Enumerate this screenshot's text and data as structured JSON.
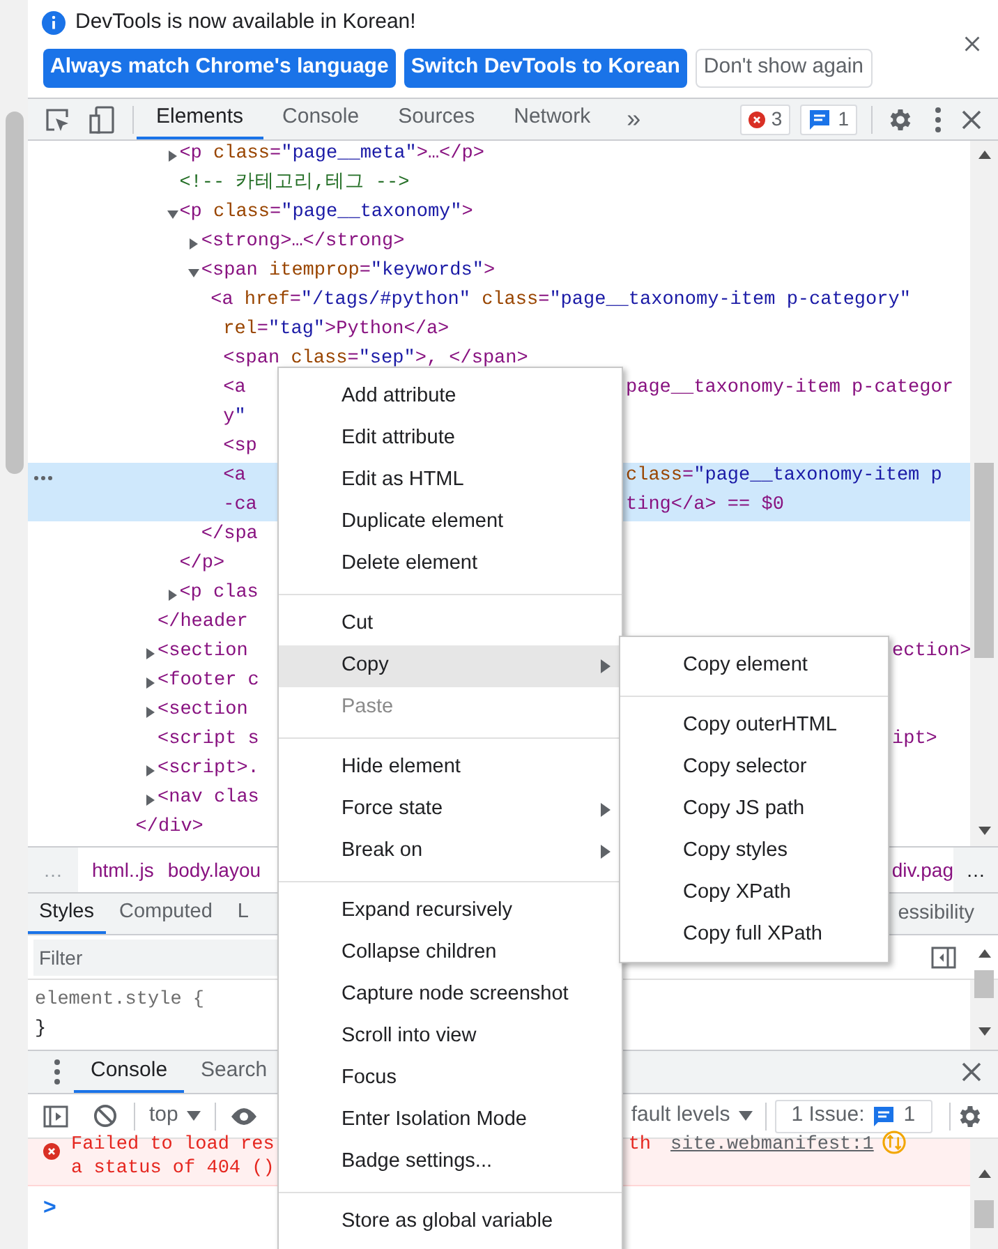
{
  "infobar": {
    "message": "DevTools is now available in Korean!",
    "buttons": [
      {
        "label": "Always match Chrome's language",
        "kind": "primary"
      },
      {
        "label": "Switch DevTools to Korean",
        "kind": "primary"
      },
      {
        "label": "Don't show again",
        "kind": "secondary"
      }
    ]
  },
  "toolbar": {
    "tabs": [
      {
        "label": "Elements",
        "selected": true
      },
      {
        "label": "Console",
        "selected": false
      },
      {
        "label": "Sources",
        "selected": false
      },
      {
        "label": "Network",
        "selected": false
      }
    ],
    "more": "»",
    "errors": "3",
    "messages": "1"
  },
  "elements": {
    "root": {
      "children": [
        {
          "children": [
            {
              "lines": [
                {
                  "text": "<p class=\"page__meta\">…</p>"
                }
              ],
              "expanded": false,
              "selected": false
            },
            {
              "kind": "comment",
              "lines": [
                {
                  "text": "<!-- 카테고리,테그 -->"
                }
              ],
              "selected": false
            },
            {
              "lines": [
                {
                  "text": "<p class=\"page__taxonomy\">"
                }
              ],
              "expanded": true,
              "selected": false,
              "children": [
                {
                  "lines": [
                    {
                      "text": "<strong>…</strong>"
                    }
                  ],
                  "expanded": false,
                  "selected": false
                },
                {
                  "lines": [
                    {
                      "text": "<span itemprop=\"keywords\">"
                    }
                  ],
                  "expanded": true,
                  "selected": false,
                  "children": [
                    {
                      "lines": [
                        {
                          "text": "<a href=\"/tags/#python\" class=\"page__taxonomy-item p-category\""
                        },
                        {
                          "text": "rel=\"tag\">Python</a>"
                        }
                      ],
                      "selected": false
                    },
                    {
                      "lines": [
                        {
                          "text": "<span class=\"sep\">, </span>"
                        }
                      ],
                      "selected": false
                    },
                    {
                      "lines": [
                        {
                          "text": "<a",
                          "after_menu": "page__taxonomy-item p-categor"
                        },
                        {
                          "text": "y\""
                        }
                      ],
                      "selected": false
                    },
                    {
                      "lines": [
                        {
                          "text": "<sp"
                        }
                      ],
                      "selected": false
                    },
                    {
                      "lines": [
                        {
                          "text": "<a",
                          "after_menu": "class=\"page__taxonomy-item p"
                        },
                        {
                          "text": "-ca",
                          "after_menu": "ting</a> == $0"
                        }
                      ],
                      "selected": true
                    }
                  ],
                  "close": "</spa"
                }
              ],
              "close": "</p>"
            },
            {
              "lines": [
                {
                  "text": "<p clas"
                }
              ],
              "expanded": false,
              "selected": false
            }
          ],
          "close": "</header"
        },
        {
          "lines": [
            {
              "text": "<section",
              "after_submenu": "ection>"
            }
          ],
          "expanded": false,
          "selected": false
        },
        {
          "lines": [
            {
              "text": "<footer c"
            }
          ],
          "expanded": false,
          "selected": false
        },
        {
          "lines": [
            {
              "text": "<section"
            }
          ],
          "expanded": false,
          "selected": false
        },
        {
          "lines": [
            {
              "text": "<script s",
              "after_submenu": "ipt>"
            }
          ],
          "selected": false
        },
        {
          "lines": [
            {
              "text": "<script>."
            }
          ],
          "expanded": false,
          "selected": false
        },
        {
          "lines": [
            {
              "text": "<nav clas"
            }
          ],
          "expanded": false,
          "selected": false
        }
      ],
      "close": "</div>"
    }
  },
  "breadcrumbs": {
    "more_left": "…",
    "items": [
      "html..js",
      "body.layou"
    ],
    "right": "div.pag",
    "more_right": "…"
  },
  "styles": {
    "tabs": [
      {
        "label": "Styles",
        "selected": true
      },
      {
        "label": "Computed",
        "selected": false
      },
      {
        "label": "L",
        "selected": false
      }
    ],
    "right_tab": "essibility",
    "filter_placeholder": "Filter",
    "rule_open": "element.style {",
    "rule_close": "}"
  },
  "drawer": {
    "tabs": [
      {
        "label": "Console",
        "selected": true
      },
      {
        "label": "Search",
        "selected": false
      }
    ],
    "context": "top",
    "levels": "fault levels",
    "issues_label": "1 Issue:",
    "issues_count": "1",
    "error": {
      "lines": [
        "Failed to load res",
        "a status of 404 ()"
      ],
      "right": "th",
      "source": "site.webmanifest:1"
    },
    "prompt": ">"
  },
  "context_menu": {
    "items": [
      {
        "kind": "item",
        "label": "Add attribute",
        "submenu": false,
        "selected": false,
        "disabled": false
      },
      {
        "kind": "item",
        "label": "Edit attribute",
        "submenu": false,
        "selected": false,
        "disabled": false
      },
      {
        "kind": "item",
        "label": "Edit as HTML",
        "submenu": false,
        "selected": false,
        "disabled": false
      },
      {
        "kind": "item",
        "label": "Duplicate element",
        "submenu": false,
        "selected": false,
        "disabled": false
      },
      {
        "kind": "item",
        "label": "Delete element",
        "submenu": false,
        "selected": false,
        "disabled": false
      },
      {
        "kind": "separator"
      },
      {
        "kind": "item",
        "label": "Cut",
        "submenu": false,
        "selected": false,
        "disabled": false
      },
      {
        "kind": "item",
        "label": "Copy",
        "submenu": true,
        "selected": true,
        "disabled": false
      },
      {
        "kind": "item",
        "label": "Paste",
        "submenu": false,
        "selected": false,
        "disabled": true
      },
      {
        "kind": "separator"
      },
      {
        "kind": "item",
        "label": "Hide element",
        "submenu": false,
        "selected": false,
        "disabled": false
      },
      {
        "kind": "item",
        "label": "Force state",
        "submenu": true,
        "selected": false,
        "disabled": false
      },
      {
        "kind": "item",
        "label": "Break on",
        "submenu": true,
        "selected": false,
        "disabled": false
      },
      {
        "kind": "separator"
      },
      {
        "kind": "item",
        "label": "Expand recursively",
        "submenu": false,
        "selected": false,
        "disabled": false
      },
      {
        "kind": "item",
        "label": "Collapse children",
        "submenu": false,
        "selected": false,
        "disabled": false
      },
      {
        "kind": "item",
        "label": "Capture node screenshot",
        "submenu": false,
        "selected": false,
        "disabled": false
      },
      {
        "kind": "item",
        "label": "Scroll into view",
        "submenu": false,
        "selected": false,
        "disabled": false
      },
      {
        "kind": "item",
        "label": "Focus",
        "submenu": false,
        "selected": false,
        "disabled": false
      },
      {
        "kind": "item",
        "label": "Enter Isolation Mode",
        "submenu": false,
        "selected": false,
        "disabled": false
      },
      {
        "kind": "item",
        "label": "Badge settings...",
        "submenu": false,
        "selected": false,
        "disabled": false
      },
      {
        "kind": "separator"
      },
      {
        "kind": "item",
        "label": "Store as global variable",
        "submenu": false,
        "selected": false,
        "disabled": false
      }
    ]
  },
  "copy_submenu": {
    "items": [
      {
        "kind": "item",
        "label": "Copy element",
        "selected": false
      },
      {
        "kind": "separator"
      },
      {
        "kind": "item",
        "label": "Copy outerHTML",
        "selected": false
      },
      {
        "kind": "item",
        "label": "Copy selector",
        "selected": false
      },
      {
        "kind": "item",
        "label": "Copy JS path",
        "selected": false
      },
      {
        "kind": "item",
        "label": "Copy styles",
        "selected": false
      },
      {
        "kind": "item",
        "label": "Copy XPath",
        "selected": false
      },
      {
        "kind": "item",
        "label": "Copy full XPath",
        "selected": false
      }
    ]
  }
}
